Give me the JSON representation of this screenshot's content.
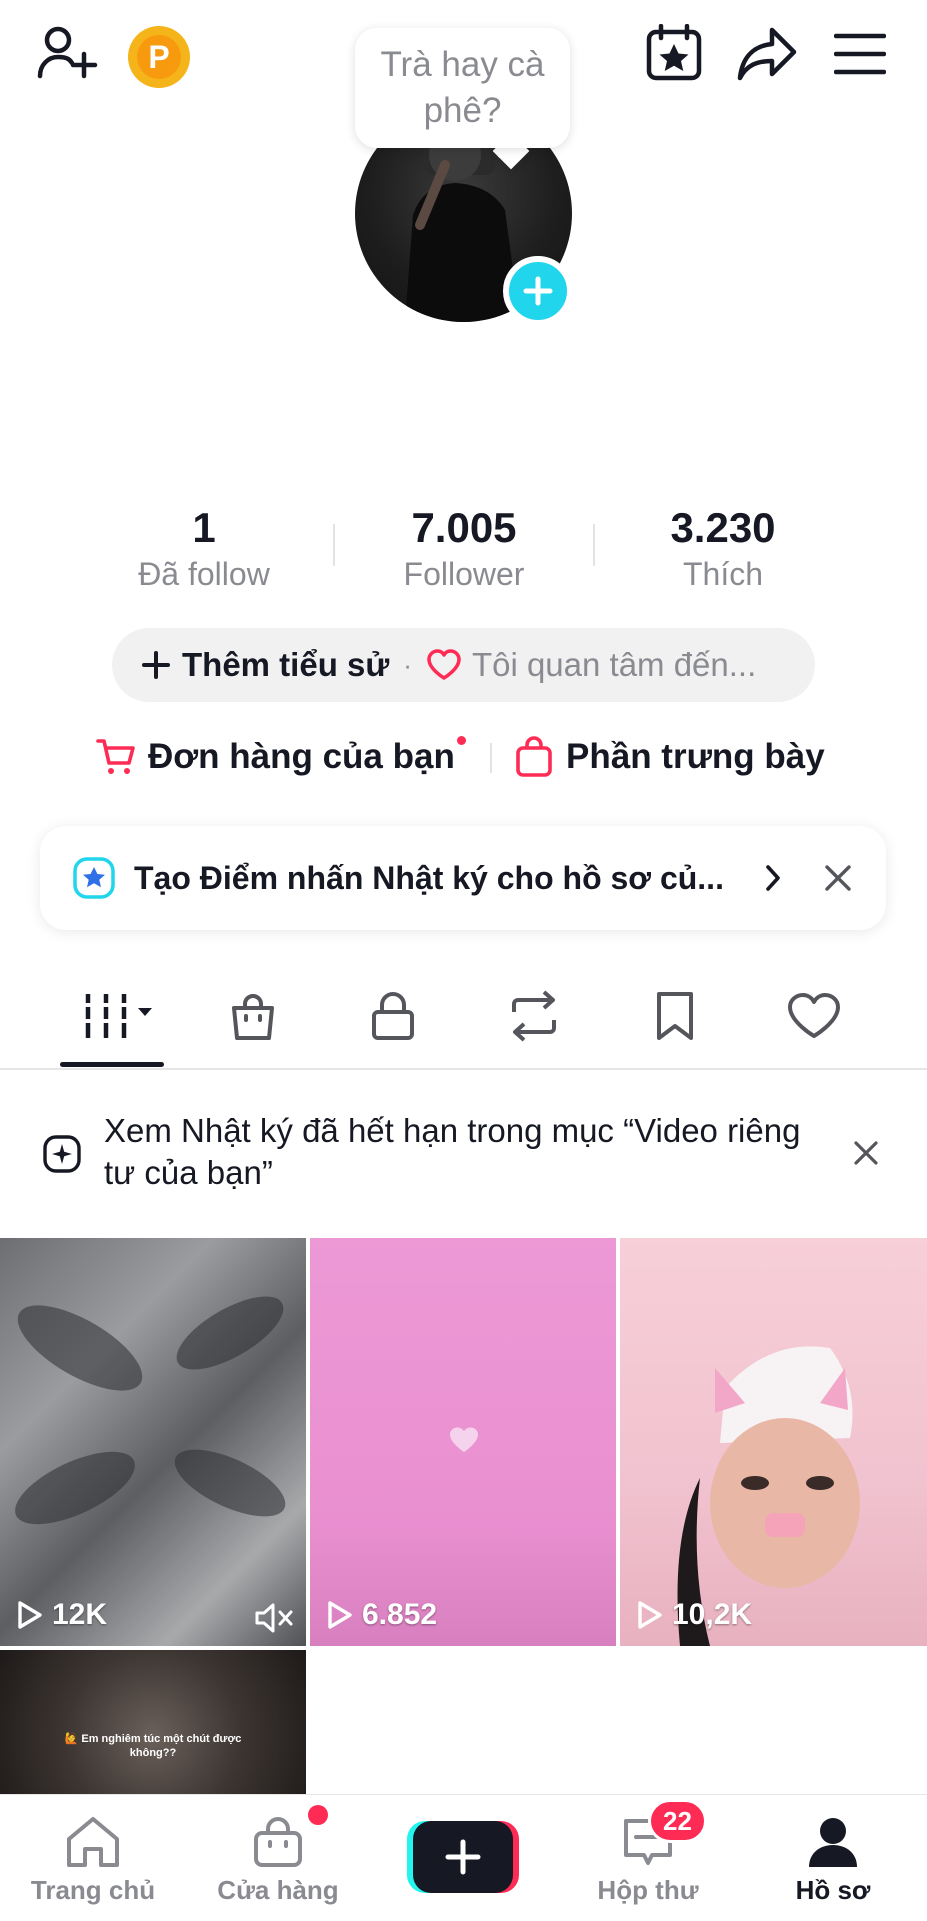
{
  "bubble": {
    "text": "Trà hay cà phê?"
  },
  "stats": [
    {
      "value": "1",
      "label": "Đã follow"
    },
    {
      "value": "7.005",
      "label": "Follower"
    },
    {
      "value": "3.230",
      "label": "Thích"
    }
  ],
  "bio": {
    "add_label": "Thêm tiểu sử",
    "separator": "·",
    "interest_label": "Tôi quan tâm đến..."
  },
  "shop": {
    "orders_label": "Đơn hàng của bạn",
    "showcase_label": "Phần trưng bày"
  },
  "highlight_card": {
    "text": "Tạo Điểm nhấn Nhật ký cho hồ sơ củ..."
  },
  "notice": {
    "text": "Xem Nhật ký đã hết hạn trong mục “Video riêng tư của bạn”"
  },
  "videos": [
    {
      "views": "12K",
      "muted": true
    },
    {
      "views": "6.852",
      "muted": false
    },
    {
      "views": "10,2K",
      "muted": false
    },
    {
      "views": "",
      "caption": "🙋 Em nghiêm túc một chút được không??"
    }
  ],
  "bottom_nav": [
    {
      "label": "Trang chủ"
    },
    {
      "label": "Cửa hàng"
    },
    {
      "label": ""
    },
    {
      "label": "Hộp thư",
      "badge": "22"
    },
    {
      "label": "Hồ sơ"
    }
  ],
  "colors": {
    "accent_cyan": "#20d5ec",
    "accent_red": "#fe2c55",
    "text_dark": "#161823",
    "text_gray": "#8a8b91",
    "coin": "#f6b41b"
  }
}
